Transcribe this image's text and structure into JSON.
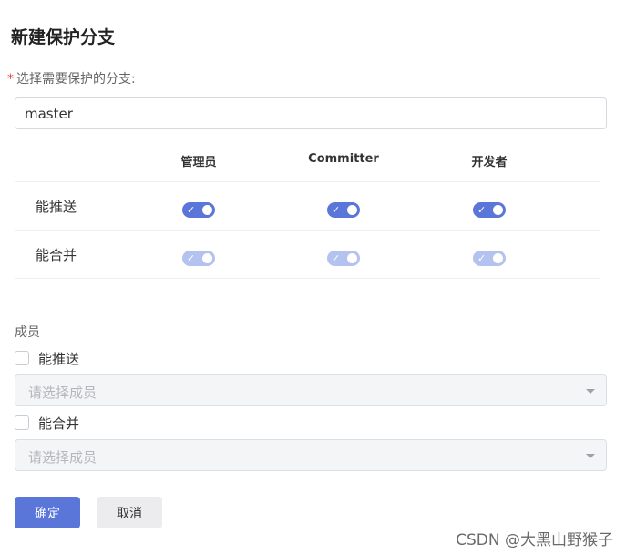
{
  "dialog": {
    "title": "新建保护分支"
  },
  "branch": {
    "required_mark": "*",
    "label": "选择需要保护的分支:",
    "value": "master"
  },
  "permissions": {
    "columns": [
      "管理员",
      "Committer",
      "开发者"
    ],
    "rows": [
      {
        "label": "能推送",
        "values": [
          true,
          true,
          true
        ],
        "disabled": false
      },
      {
        "label": "能合并",
        "values": [
          true,
          true,
          true
        ],
        "disabled": true
      }
    ],
    "toggle_on_color": "#5b76d9",
    "toggle_disabled_color": "#b3c2ee"
  },
  "members": {
    "label": "成员",
    "push": {
      "label": "能推送",
      "checked": false,
      "placeholder": "请选择成员"
    },
    "merge": {
      "label": "能合并",
      "checked": false,
      "placeholder": "请选择成员"
    }
  },
  "actions": {
    "confirm": "确定",
    "cancel": "取消"
  },
  "watermark": "CSDN @大黑山野猴子"
}
